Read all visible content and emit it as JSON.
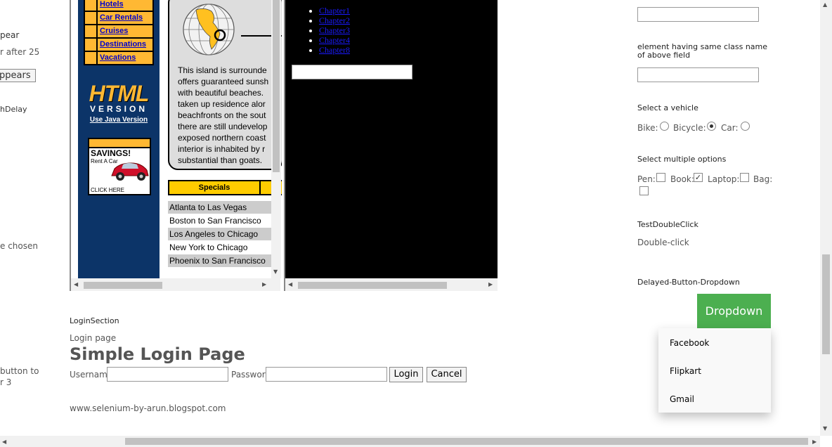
{
  "left_partial": {
    "appear_text": "pear",
    "after_text": "r after 25",
    "appears_button": "ppears",
    "delay_text": "hDelay",
    "chosen_text": "e chosen",
    "button_to_text": "button to",
    "r3_text": "r 3"
  },
  "frame1": {
    "nav_items": [
      "Hotels",
      "Car Rentals",
      "Cruises",
      "Destinations",
      "Vacations"
    ],
    "logo_big": "HTML",
    "logo_version": "VERSION",
    "java_link": "Use Java Version",
    "ad": {
      "title": "SAVINGS!",
      "subtitle": "Rent A Car",
      "cta": "CLICK HERE"
    },
    "info_lines": [
      "This island is surrounde",
      "offers guaranteed sunsh",
      "with beautiful beaches.",
      "taken up residence alor",
      "beachfronts on the sout",
      "there are still undevelop",
      "exposed northern coast",
      "interior is inhabited by r",
      "substantial than goats."
    ],
    "specials_label": "Specials",
    "routes": [
      "Atlanta to Las Vegas",
      "Boston to San Francisco",
      "Los Angeles to Chicago",
      "New York to Chicago",
      "Phoenix to San Francisco"
    ]
  },
  "frame2": {
    "chapters": [
      "Chapter1",
      "Chapter2",
      "Chapter3",
      "Chapter4",
      "Chapter8"
    ],
    "input_value": ""
  },
  "login": {
    "section_title": "LoginSection",
    "subtitle": "Login page",
    "heading": "Simple Login Page",
    "username_label": "Username",
    "username_value": "",
    "password_label": "Password",
    "password_value": "",
    "login_button": "Login",
    "cancel_button": "Cancel",
    "footer": "www.selenium-by-arun.blogspot.com"
  },
  "right": {
    "top_input_value": "",
    "same_class_label": "element having same class name of above field",
    "same_class_value": "",
    "vehicle_title": "Select a vehicle",
    "vehicles": [
      {
        "label": "Bike:",
        "selected": false
      },
      {
        "label": "Bicycle:",
        "selected": true
      },
      {
        "label": "Car:",
        "selected": false
      }
    ],
    "multi_title": "Select multiple options",
    "options": [
      {
        "label": "Pen:",
        "checked": false
      },
      {
        "label": "Book:",
        "checked": true
      },
      {
        "label": "Laptop:",
        "checked": false
      },
      {
        "label": "Bag:",
        "checked": false
      }
    ],
    "doubleclick_title": "TestDoubleClick",
    "doubleclick_text": "Double-click",
    "delayed_title": "Delayed-Button-Dropdown",
    "dropdown_button": "Dropdown",
    "dropdown_items": [
      "Facebook",
      "Flipkart",
      "Gmail"
    ]
  },
  "colors": {
    "nav_bg": "#0c3468",
    "nav_item_bg": "#ffb833",
    "dropdown_green": "#4caf50"
  }
}
